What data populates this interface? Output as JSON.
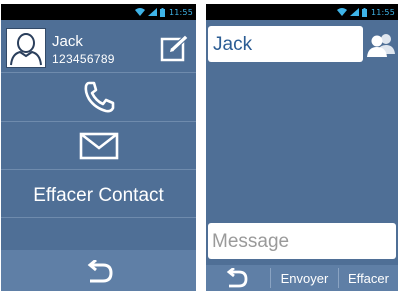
{
  "colors": {
    "background": "#4f6f96",
    "bottom_bar": "#5f7fa6",
    "status_bar": "#000000",
    "status_icons": "#3fb4e8",
    "name_text": "#2c5d94",
    "placeholder_text": "#9a9a9a"
  },
  "status_bar": {
    "time": "11:55",
    "icons": [
      "wifi-icon",
      "signal-icon",
      "battery-icon"
    ]
  },
  "contact_screen": {
    "contact_name": "Jack",
    "contact_number": "123456789",
    "avatar_icon": "person-icon",
    "edit_icon": "edit-icon",
    "call_icon": "phone-icon",
    "message_icon": "envelope-icon",
    "delete_label": "Effacer Contact",
    "back_icon": "back-arrow-icon"
  },
  "message_screen": {
    "recipient_value": "Jack",
    "contacts_icon": "contacts-icon",
    "message_placeholder": "Message",
    "back_icon": "back-arrow-icon",
    "send_label": "Envoyer",
    "clear_label": "Effacer"
  }
}
